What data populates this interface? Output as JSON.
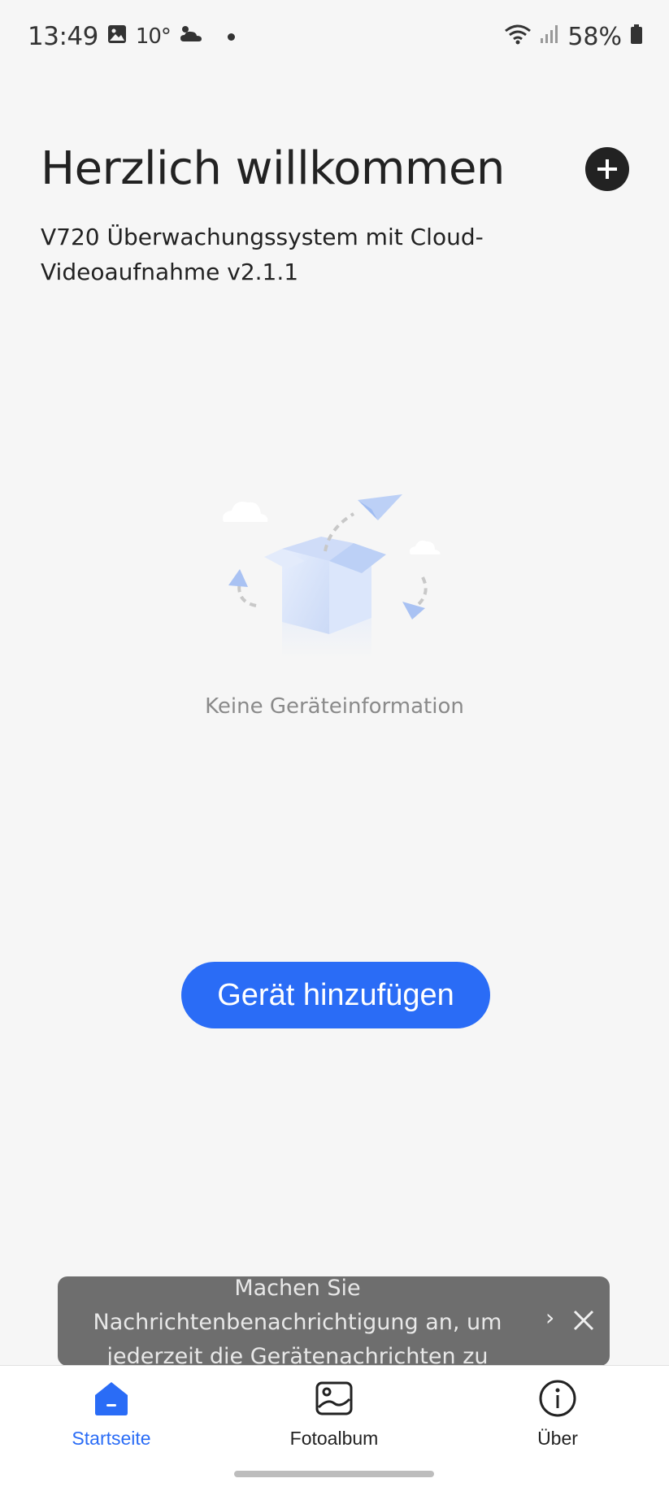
{
  "status_bar": {
    "time": "13:49",
    "temperature": "10°",
    "battery": "58%"
  },
  "header": {
    "title": "Herzlich willkommen",
    "subtitle": "V720 Überwachungssystem mit Cloud-Videoaufnahme v2.1.1",
    "add_icon": "plus-circle-icon"
  },
  "empty_state": {
    "message": "Keine Geräteinformation"
  },
  "actions": {
    "add_device_label": "Gerät hinzufügen"
  },
  "toast": {
    "message": "Machen Sie Nachrichtenbenachrichtigung an, um jederzeit die Gerätenachrichten zu erhalten",
    "chevron": "›"
  },
  "bottom_nav": {
    "items": [
      {
        "label": "Startseite",
        "icon": "home-icon",
        "active": true
      },
      {
        "label": "Fotoalbum",
        "icon": "photo-album-icon",
        "active": false
      },
      {
        "label": "Über",
        "icon": "info-icon",
        "active": false
      }
    ]
  },
  "colors": {
    "accent": "#2a6cf6",
    "background": "#f6f6f6",
    "toast_bg": "#6e6e6e"
  }
}
